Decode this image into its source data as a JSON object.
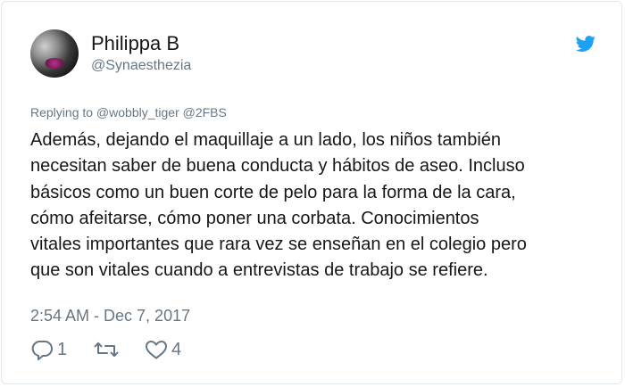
{
  "author": {
    "display_name": "Philippa B",
    "handle": "@Synaesthezia"
  },
  "reply": {
    "text": "Replying to @wobbly_tiger @2FBS"
  },
  "tweet": {
    "lines": [
      "Además, dejando el maquillaje a un lado, los niños también",
      "necesitan saber de buena conducta y hábitos de aseo. Incluso",
      "básicos como un buen corte de pelo para la forma de la cara,",
      "cómo afeitarse, cómo poner una corbata. Conocimientos",
      "vitales importantes que rara vez se enseñan en el colegio pero",
      "que son vitales cuando a entrevistas de trabajo se refiere."
    ],
    "timestamp": "2:54 AM - Dec 7, 2017"
  },
  "actions": {
    "reply": {
      "icon": "reply-icon",
      "count": "1"
    },
    "retweet": {
      "icon": "retweet-icon",
      "count": ""
    },
    "like": {
      "icon": "heart-icon",
      "count": "4"
    }
  },
  "colors": {
    "twitter_blue": "#1da1f2",
    "secondary_text": "#657786",
    "primary_text": "#14171a"
  }
}
